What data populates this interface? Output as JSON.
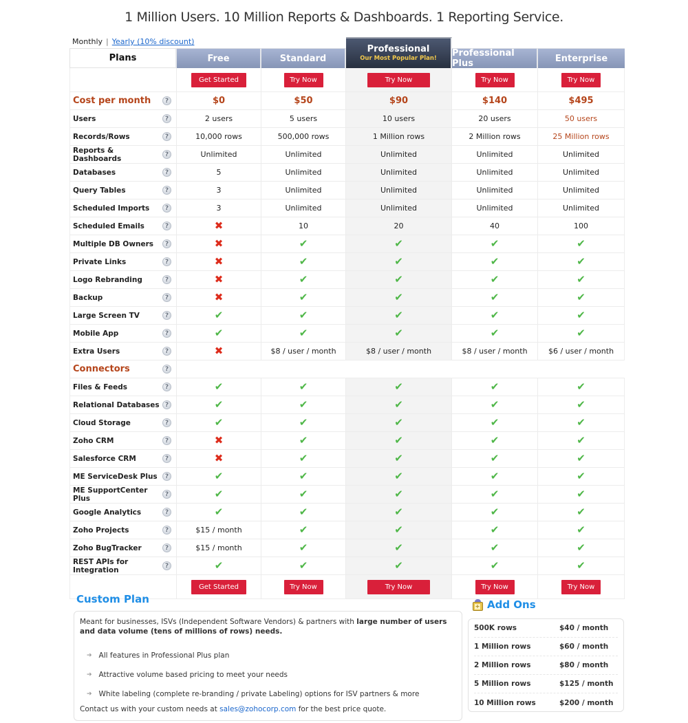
{
  "headline": "1 Million Users. 10 Million Reports & Dashboards. 1 Reporting Service.",
  "billing": {
    "monthly_label": "Monthly",
    "separator": "|",
    "yearly_label": "Yearly (10% discount)"
  },
  "plans_header": "Plans",
  "plans": [
    {
      "name": "Free",
      "button": "Get Started"
    },
    {
      "name": "Standard",
      "button": "Try Now"
    },
    {
      "name": "Professional",
      "tagline": "Our Most Popular Plan!",
      "button": "Try Now",
      "highlighted": true
    },
    {
      "name": "Professional Plus",
      "button": "Try Now"
    },
    {
      "name": "Enterprise",
      "button": "Try Now"
    }
  ],
  "cost": {
    "label": "Cost per month",
    "values": [
      "$0",
      "$50",
      "$90",
      "$140",
      "$495"
    ]
  },
  "features": [
    {
      "label": "Users",
      "values": [
        "2 users",
        "5 users",
        "10 users",
        "20 users",
        "50 users"
      ]
    },
    {
      "label": "Records/Rows",
      "values": [
        "10,000 rows",
        "500,000 rows",
        "1 Million rows",
        "2 Million rows",
        "25 Million rows"
      ]
    },
    {
      "label": "Reports & Dashboards",
      "values": [
        "Unlimited",
        "Unlimited",
        "Unlimited",
        "Unlimited",
        "Unlimited"
      ]
    },
    {
      "label": "Databases",
      "values": [
        "5",
        "Unlimited",
        "Unlimited",
        "Unlimited",
        "Unlimited"
      ]
    },
    {
      "label": "Query Tables",
      "values": [
        "3",
        "Unlimited",
        "Unlimited",
        "Unlimited",
        "Unlimited"
      ]
    },
    {
      "label": "Scheduled Imports",
      "values": [
        "3",
        "Unlimited",
        "Unlimited",
        "Unlimited",
        "Unlimited"
      ]
    },
    {
      "label": "Scheduled Emails",
      "values": [
        "no",
        "10",
        "20",
        "40",
        "100"
      ]
    },
    {
      "label": "Multiple DB Owners",
      "values": [
        "no",
        "yes",
        "yes",
        "yes",
        "yes"
      ]
    },
    {
      "label": "Private Links",
      "values": [
        "no",
        "yes",
        "yes",
        "yes",
        "yes"
      ]
    },
    {
      "label": "Logo Rebranding",
      "values": [
        "no",
        "yes",
        "yes",
        "yes",
        "yes"
      ]
    },
    {
      "label": "Backup",
      "values": [
        "no",
        "yes",
        "yes",
        "yes",
        "yes"
      ]
    },
    {
      "label": "Large Screen TV",
      "values": [
        "yes",
        "yes",
        "yes",
        "yes",
        "yes"
      ]
    },
    {
      "label": "Mobile App",
      "values": [
        "yes",
        "yes",
        "yes",
        "yes",
        "yes"
      ]
    },
    {
      "label": "Extra Users",
      "values": [
        "no",
        "$8 / user / month",
        "$8 / user / month",
        "$8 / user / month",
        "$6 / user / month"
      ]
    }
  ],
  "connectors": {
    "label": "Connectors",
    "items": [
      {
        "label": "Files & Feeds",
        "values": [
          "yes",
          "yes",
          "yes",
          "yes",
          "yes"
        ]
      },
      {
        "label": "Relational Databases",
        "values": [
          "yes",
          "yes",
          "yes",
          "yes",
          "yes"
        ]
      },
      {
        "label": "Cloud Storage",
        "values": [
          "yes",
          "yes",
          "yes",
          "yes",
          "yes"
        ]
      },
      {
        "label": "Zoho CRM",
        "values": [
          "no",
          "yes",
          "yes",
          "yes",
          "yes"
        ]
      },
      {
        "label": "Salesforce CRM",
        "values": [
          "no",
          "yes",
          "yes",
          "yes",
          "yes"
        ]
      },
      {
        "label": "ME ServiceDesk Plus",
        "values": [
          "yes",
          "yes",
          "yes",
          "yes",
          "yes"
        ]
      },
      {
        "label": "ME SupportCenter Plus",
        "values": [
          "yes",
          "yes",
          "yes",
          "yes",
          "yes"
        ]
      },
      {
        "label": "Google Analytics",
        "values": [
          "yes",
          "yes",
          "yes",
          "yes",
          "yes"
        ]
      },
      {
        "label": "Zoho Projects",
        "values": [
          "$15 / month",
          "yes",
          "yes",
          "yes",
          "yes"
        ]
      },
      {
        "label": "Zoho BugTracker",
        "values": [
          "$15 / month",
          "yes",
          "yes",
          "yes",
          "yes"
        ]
      },
      {
        "label": "REST APIs for Integration",
        "values": [
          "yes",
          "yes",
          "yes",
          "yes",
          "yes"
        ]
      }
    ]
  },
  "icons": {
    "yes": "✔",
    "no": "✖",
    "help": "?"
  },
  "custom_plan": {
    "title": "Custom Plan",
    "intro_plain": "Meant for businesses, ISVs (Independent Software Vendors) & partners with ",
    "intro_bold": "large number of users and data volume (tens of millions of rows) needs.",
    "bullets": [
      "All features in Professional Plus plan",
      "Attractive volume based pricing to meet your needs",
      "White labeling (complete re-branding / private Labeling) options for ISV partners & more"
    ],
    "contact_prefix": "Contact us with your custom needs at ",
    "contact_email": "sales@zohocorp.com",
    "contact_suffix": " for the best price quote."
  },
  "add_ons": {
    "title": "Add Ons",
    "items": [
      {
        "name": "500K rows",
        "price": "$40 / month"
      },
      {
        "name": "1 Million rows",
        "price": "$60 / month"
      },
      {
        "name": "2 Million rows",
        "price": "$80 / month"
      },
      {
        "name": "5 Million rows",
        "price": "$125 / month"
      },
      {
        "name": "10 Million rows",
        "price": "$200 / month"
      }
    ]
  },
  "colors": {
    "accent_red": "#d9203a",
    "cost_brown": "#b5451b",
    "check_green": "#4fb748",
    "cross_red": "#dd2c1c",
    "title_blue": "#1f8ee6",
    "popular_yellow": "#f2c94c"
  }
}
